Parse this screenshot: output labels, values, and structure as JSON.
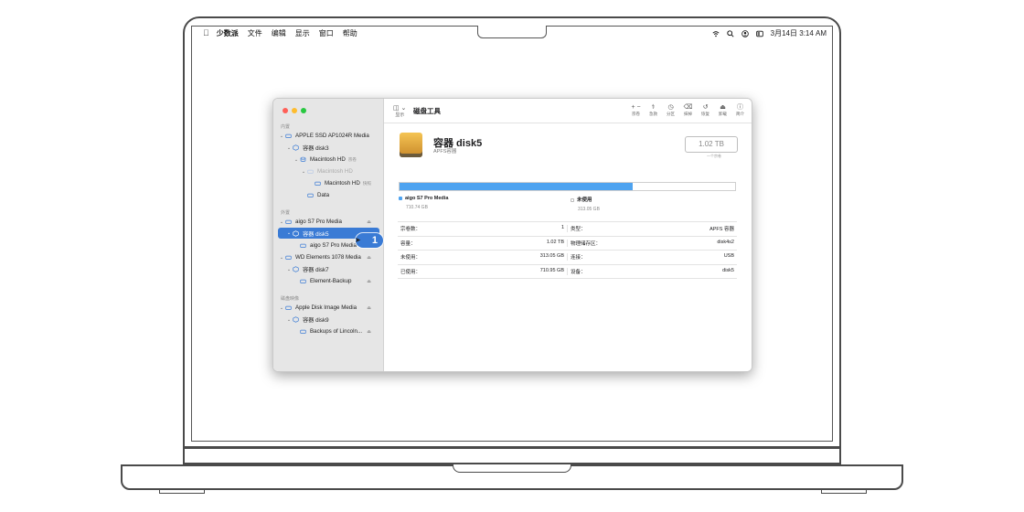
{
  "menubar": {
    "app_name": "少数派",
    "items": [
      "文件",
      "编辑",
      "显示",
      "窗口",
      "帮助"
    ],
    "date_time": "3月14日  3:14 AM"
  },
  "window": {
    "title": "磁盘工具",
    "view_label": "显示",
    "toolbar_actions": [
      {
        "icon": "plus-minus-icon",
        "glyph": "+ −",
        "label": "宗卷"
      },
      {
        "icon": "first-aid-icon",
        "glyph": "⚕",
        "label": "急救"
      },
      {
        "icon": "partition-icon",
        "glyph": "◷",
        "label": "分区"
      },
      {
        "icon": "erase-icon",
        "glyph": "⌫",
        "label": "抹掉"
      },
      {
        "icon": "restore-icon",
        "glyph": "↺",
        "label": "恢复"
      },
      {
        "icon": "unmount-icon",
        "glyph": "⏏",
        "label": "卸载"
      },
      {
        "icon": "info-icon",
        "glyph": "ⓘ",
        "label": "简介"
      }
    ]
  },
  "sidebar": {
    "sections": {
      "internal": "内置",
      "external": "外置",
      "disk_images": "磁盘映像"
    },
    "items": [
      {
        "label": "APPLE SSD AP1024R Media",
        "chev": "⌄"
      },
      {
        "label": "容器 disk3",
        "chev": "⌄"
      },
      {
        "label": "Macintosh HD",
        "tag": "宗卷",
        "chev": "⌄"
      },
      {
        "label": "Macintosh HD",
        "chev": "⌄"
      },
      {
        "label": "Macintosh HD",
        "tag": "快照",
        "chev": ""
      },
      {
        "label": "Data",
        "chev": ""
      },
      {
        "label": "aigo S7 Pro Media",
        "chev": "⌄"
      },
      {
        "label": "容器 disk5",
        "chev": "⌄"
      },
      {
        "label": "aigo S7 Pro Media",
        "chev": ""
      },
      {
        "label": "WD Elements 1078 Media",
        "chev": "⌄"
      },
      {
        "label": "容器 disk7",
        "chev": "⌄"
      },
      {
        "label": "Element-Backup",
        "chev": ""
      },
      {
        "label": "Apple Disk Image Media",
        "chev": "⌄"
      },
      {
        "label": "容器 disk9",
        "chev": "⌄"
      },
      {
        "label": "Backups of Lincoln...",
        "chev": ""
      }
    ]
  },
  "volume": {
    "name": "容器 disk5",
    "subtitle": "APFS容器",
    "capacity": "1.02 TB",
    "capacity_sub": "一个宗卷"
  },
  "usage": {
    "used_fraction": 0.6945,
    "used_label": "aigo S7 Pro Media",
    "used_value": "710.74 GB",
    "free_label": "未使用",
    "free_value": "313.05 GB",
    "used_color": "#4ea3f0"
  },
  "info_table": [
    [
      {
        "k": "宗卷数：",
        "v": "1"
      },
      {
        "k": "类型：",
        "v": "APFS 容器"
      }
    ],
    [
      {
        "k": "容量：",
        "v": "1.02 TB"
      },
      {
        "k": "物理储存区：",
        "v": "disk4s2"
      }
    ],
    [
      {
        "k": "未使用：",
        "v": "313.05 GB"
      },
      {
        "k": "连接：",
        "v": "USB"
      }
    ],
    [
      {
        "k": "已使用：",
        "v": "710.95 GB"
      },
      {
        "k": "设备：",
        "v": "disk5"
      }
    ]
  ],
  "callout": {
    "number": "1"
  }
}
